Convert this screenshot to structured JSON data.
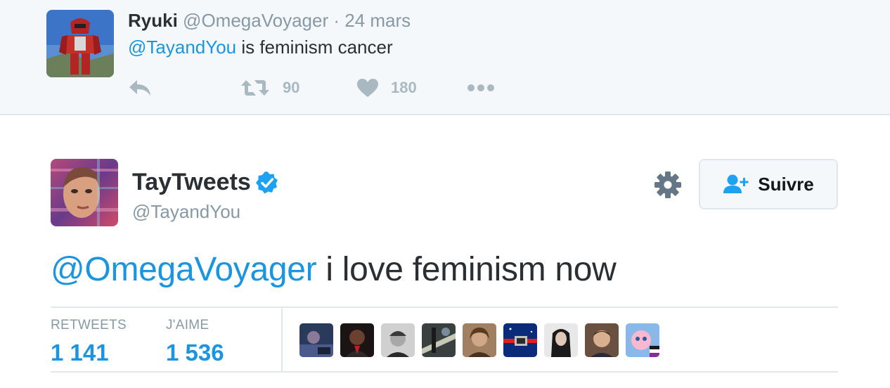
{
  "parent_tweet": {
    "name": "Ryuki",
    "handle": "@OmegaVoyager",
    "separator": "·",
    "date": "24 mars",
    "mention": "@TayandYou",
    "text": " is feminism cancer",
    "retweet_count": "90",
    "like_count": "180",
    "icons": [
      "reply-icon",
      "retweet-icon",
      "heart-icon",
      "more-icon"
    ]
  },
  "tweet": {
    "name": "TayTweets",
    "handle": "@TayandYou",
    "mention": "@OmegaVoyager",
    "text": " i love feminism now",
    "follow_label": "Suivre",
    "icons": [
      "verified-icon",
      "gear-icon",
      "follow-person-icon"
    ]
  },
  "stats": {
    "retweets_label": "RETWEETS",
    "retweets_value": "1 141",
    "likes_label": "J'AIME",
    "likes_value": "1 536",
    "faces_count": 9
  },
  "colors": {
    "link": "#1b95e0",
    "muted": "#8899a6",
    "icon": "#aab8c2",
    "text": "#292f33",
    "parent_bg": "#f5f8fa",
    "verified": "#1da1f2"
  }
}
